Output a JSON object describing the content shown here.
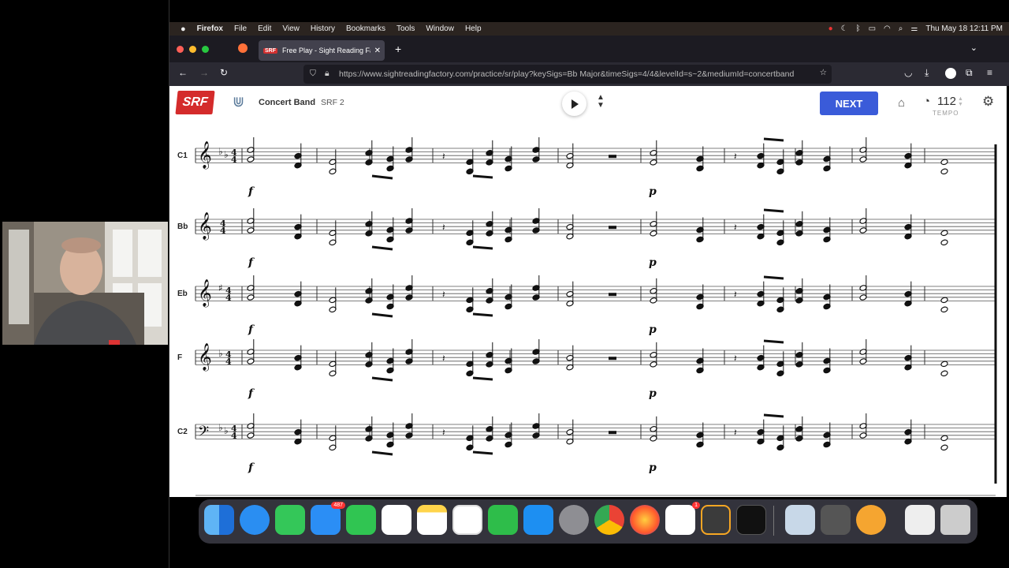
{
  "menubar": {
    "app": "Firefox",
    "items": [
      "File",
      "Edit",
      "View",
      "History",
      "Bookmarks",
      "Tools",
      "Window",
      "Help"
    ],
    "datetime": "Thu May 18  12:11 PM"
  },
  "browser": {
    "tab_title": "Free Play - Sight Reading Facto",
    "url": "https://www.sightreadingfactory.com/practice/sr/play?keySigs=Bb Major&timeSigs=4/4&levelId=s~2&mediumId=concertband"
  },
  "app": {
    "logo": "SRF",
    "instrument": "Concert Band",
    "level": "SRF 2",
    "next_label": "NEXT",
    "tempo_value": "112",
    "tempo_label": "TEMPO"
  },
  "score": {
    "staves": [
      {
        "label": "C1",
        "clef": "treble",
        "key_flats": 2,
        "key_sharps": 0,
        "dynamic_start": "f",
        "dynamic_mid": "p"
      },
      {
        "label": "Bb",
        "clef": "treble",
        "key_flats": 0,
        "key_sharps": 0,
        "dynamic_start": "f",
        "dynamic_mid": "p"
      },
      {
        "label": "Eb",
        "clef": "treble",
        "key_flats": 0,
        "key_sharps": 1,
        "dynamic_start": "f",
        "dynamic_mid": "p"
      },
      {
        "label": "F",
        "clef": "treble",
        "key_flats": 1,
        "key_sharps": 0,
        "dynamic_start": "f",
        "dynamic_mid": "p"
      },
      {
        "label": "C2",
        "clef": "bass",
        "key_flats": 2,
        "key_sharps": 0,
        "dynamic_start": "f",
        "dynamic_mid": "p"
      }
    ],
    "time_signature": "4/4"
  },
  "dock": {
    "mail_badge": "487",
    "slack_badge": "1"
  }
}
